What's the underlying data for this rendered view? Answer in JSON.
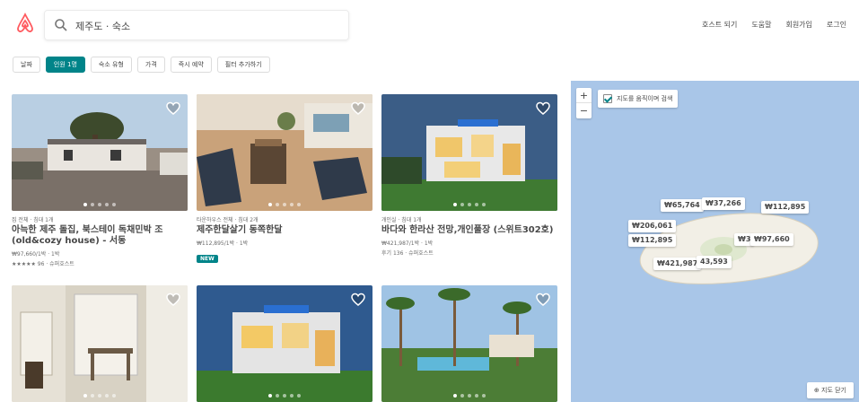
{
  "header": {
    "search_value": "제주도 · 숙소",
    "nav": [
      "호스트 되기",
      "도움말",
      "회원가입",
      "로그인"
    ]
  },
  "filters": [
    "날짜",
    "인원 1명",
    "숙소 유형",
    "가격",
    "즉시 예약",
    "필터 추가하기"
  ],
  "listings": [
    {
      "meta": "집 전체 · 침대 1개",
      "title": "아늑한 제주 돌집, 북스테이 독채민박 조(old&cozy house) - 서동",
      "price": "₩97,660/1박 · 1박",
      "rating": "★★★★★ 96 · 슈퍼호스트"
    },
    {
      "meta": "타운하우스 전체 · 침대 2개",
      "title": "제주한달살기 동쪽한달",
      "price": "₩112,895/1박 · 1박",
      "badge": "NEW"
    },
    {
      "meta": "개인실 · 침대 1개",
      "title": "바다와 한라산 전망,개인풀장 (스위트302호)",
      "price": "₩421,987/1박 · 1박",
      "rating": "후기 136 · 슈퍼호스트"
    }
  ],
  "map": {
    "checkbox_label": "지도를 움직이며 검색",
    "zoom_in": "+",
    "zoom_out": "−",
    "close_label": "⊕ 지도 닫기",
    "pins": [
      "₩65,764",
      "₩37,266",
      "₩112,895",
      "₩206,061",
      "₩112,895",
      "₩3",
      "₩97,660",
      "₩421,987",
      "43,593"
    ]
  },
  "colors": {
    "brand": "#ff5a5f",
    "accent": "#008489",
    "sea": "#a9c6e8",
    "land": "#f2efe6"
  }
}
